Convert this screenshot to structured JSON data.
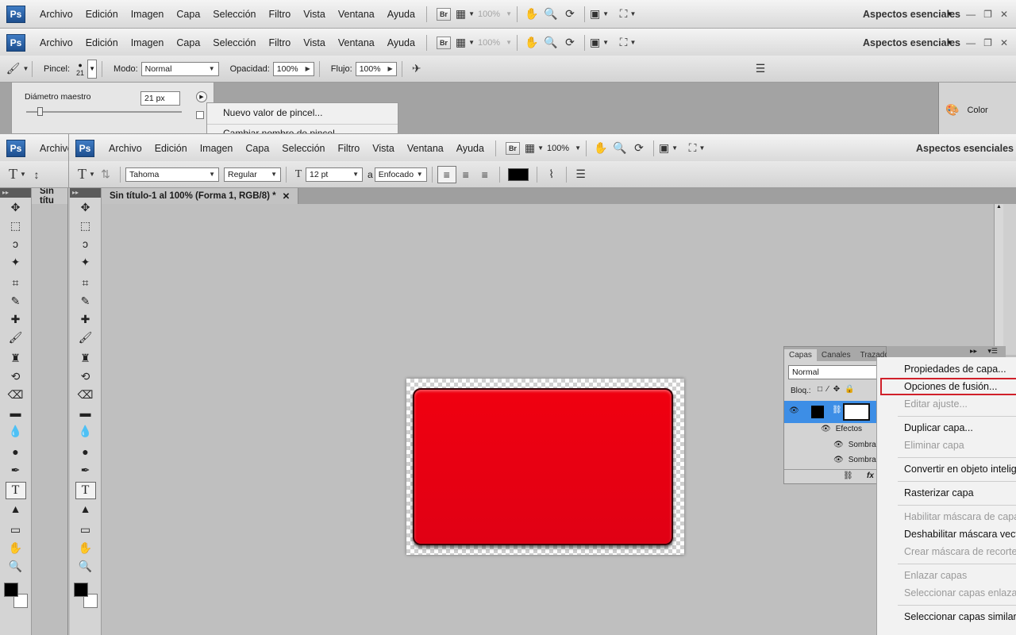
{
  "menu": {
    "logo": "Ps",
    "items": [
      "Archivo",
      "Edición",
      "Imagen",
      "Capa",
      "Selección",
      "Filtro",
      "Vista",
      "Ventana",
      "Ayuda"
    ],
    "bridge": "Br",
    "zoom_inactive": "100%",
    "zoom_active": "100%",
    "workspace": "Aspectos esenciales"
  },
  "brush_options": {
    "pincel_label": "Pincel:",
    "pincel_size": "21",
    "modo_label": "Modo:",
    "modo_value": "Normal",
    "opacidad_label": "Opacidad:",
    "opacidad_value": "100%",
    "flujo_label": "Flujo:",
    "flujo_value": "100%"
  },
  "brush_popup": {
    "label": "Diámetro maestro",
    "value": "21 px",
    "menu_items": [
      "Nuevo valor de pincel...",
      "Cambiar nombre de pincel..."
    ]
  },
  "right_panel": {
    "color_label": "Color"
  },
  "text_options": {
    "font_family": "Tahoma",
    "font_style": "Regular",
    "font_size": "12 pt",
    "aa_symbol": "a",
    "antialias": "Enfocado",
    "text_color": "#000000"
  },
  "document": {
    "tab_title": "Sin título-1 al 100% (Forma 1, RGB/8) *",
    "back_tab_title": "Sin títu",
    "shape_color": "#e8000f"
  },
  "layers_panel": {
    "tabs": [
      "Capas",
      "Canales",
      "Trazados"
    ],
    "blend_mode": "Normal",
    "lock_label": "Bloq.:",
    "effects_label": "Efectos",
    "effect_items": [
      "Sombra",
      "Sombra"
    ],
    "fx": "fx"
  },
  "context_menu": {
    "items": [
      {
        "label": "Propiedades de capa...",
        "enabled": true
      },
      {
        "label": "Opciones de fusión...",
        "enabled": true,
        "highlighted": true
      },
      {
        "label": "Editar ajuste...",
        "enabled": false
      },
      {
        "label": "Duplicar capa...",
        "enabled": true
      },
      {
        "label": "Eliminar capa",
        "enabled": false
      },
      {
        "label": "Convertir en objeto inteligente",
        "enabled": true
      },
      {
        "label": "Rasterizar capa",
        "enabled": true
      },
      {
        "label": "Habilitar máscara de capa",
        "enabled": false
      },
      {
        "label": "Deshabilitar máscara vectorial",
        "enabled": true
      },
      {
        "label": "Crear máscara de recorte",
        "enabled": false
      },
      {
        "label": "Enlazar capas",
        "enabled": false
      },
      {
        "label": "Seleccionar capas enlazadas",
        "enabled": false
      },
      {
        "label": "Seleccionar capas similares",
        "enabled": true
      }
    ],
    "highlight_color": "#d0202a"
  }
}
